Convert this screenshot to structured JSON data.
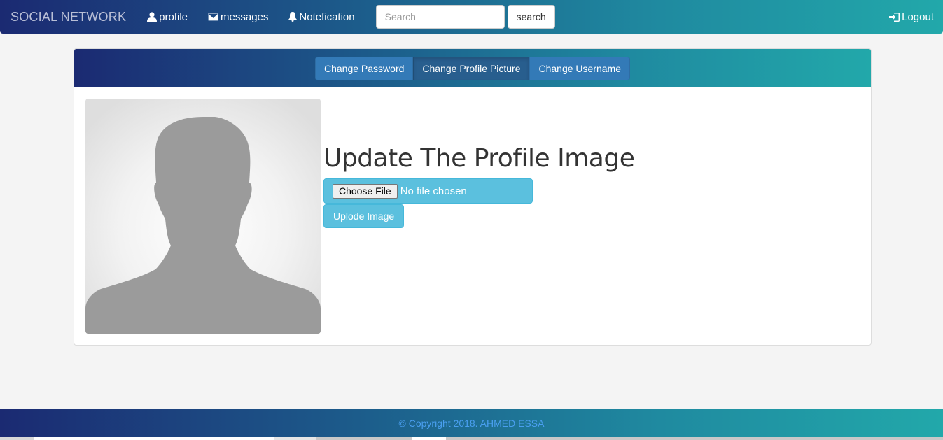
{
  "navbar": {
    "brand": "SOCIAL NETWORK",
    "links": {
      "profile": "profile",
      "messages": "messages",
      "notification": "Notefication",
      "logout": "Logout"
    },
    "search": {
      "placeholder": "Search",
      "button_label": "search"
    }
  },
  "panel": {
    "tabs": [
      {
        "label": "Change Password",
        "active": false
      },
      {
        "label": "Change Profile Picture",
        "active": true
      },
      {
        "label": "Change Username",
        "active": false
      }
    ],
    "title": "Update The Profile Image",
    "file_input": {
      "button_label": "Choose File",
      "status": "No file chosen"
    },
    "upload_button": "Uplode Image"
  },
  "footer": {
    "text": "© Copyright 2018. AHMED ESSA"
  },
  "colors": {
    "gradient_start": "#1b2a72",
    "gradient_end": "#22a8aa",
    "info_button": "#5bc0de",
    "primary_button": "#337ab7",
    "footer_text": "#4a9ff0"
  },
  "icons": {
    "profile": "user-icon",
    "messages": "envelope-icon",
    "notification": "bell-icon",
    "logout": "log-in-icon"
  }
}
